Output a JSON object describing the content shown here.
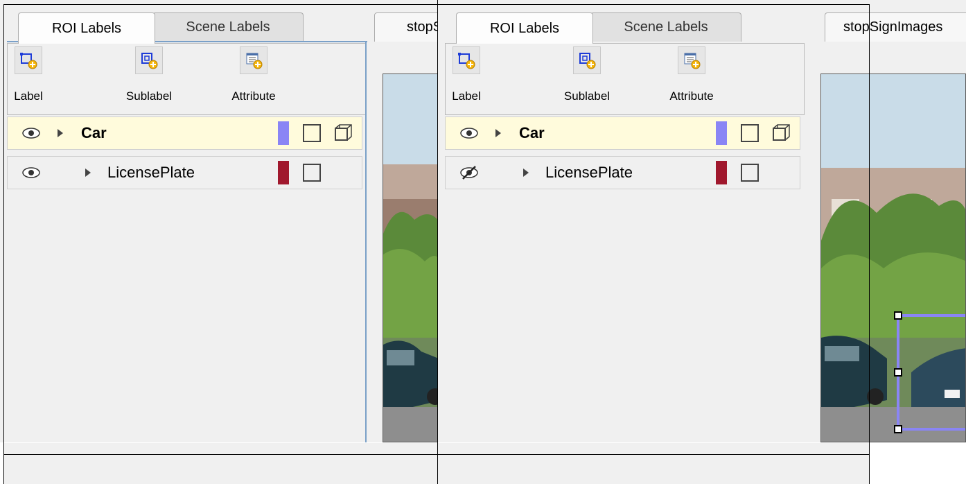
{
  "tabs": {
    "roi": "ROI Labels",
    "scene": "Scene Labels"
  },
  "toolbar": {
    "label": "Label",
    "sublabel": "Sublabel",
    "attribute": "Attribute"
  },
  "labels": {
    "car": "Car",
    "license_plate": "LicensePlate"
  },
  "colors": {
    "car": "#8a85f5",
    "license_plate": "#a0182d",
    "bbox": "#8a85f5"
  },
  "document": {
    "left_tab_visible": "stopS",
    "right_tab": "stopSignImages"
  },
  "icons": {
    "label": "rect-roi-add-icon",
    "sublabel": "sub-roi-add-icon",
    "attribute": "attribute-add-icon",
    "visible": "eye-icon",
    "hidden": "eye-crossed-icon"
  }
}
